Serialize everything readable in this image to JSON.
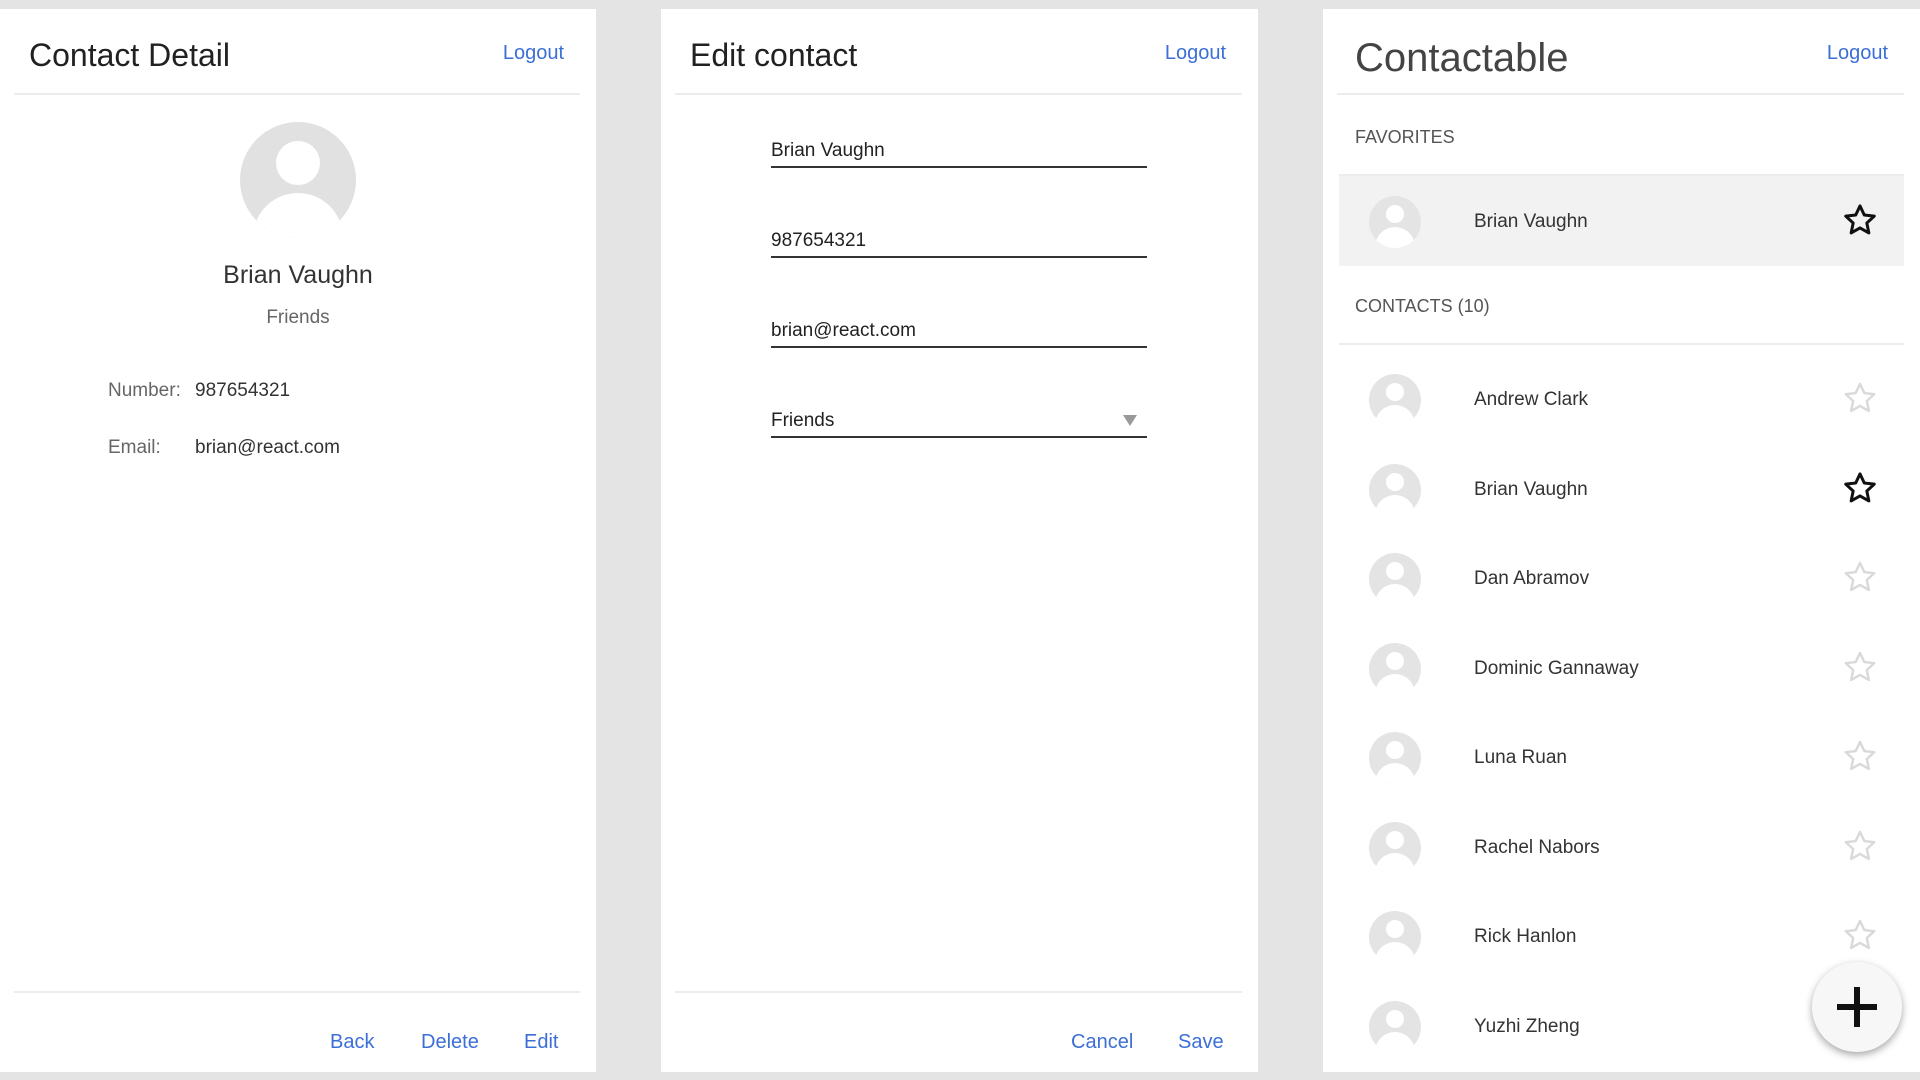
{
  "detail_panel": {
    "title": "Contact Detail",
    "logout_label": "Logout",
    "name": "Brian Vaughn",
    "group": "Friends",
    "number_label": "Number:",
    "number_value": "987654321",
    "email_label": "Email:",
    "email_value": "brian@react.com",
    "footer": {
      "back_label": "Back",
      "delete_label": "Delete",
      "edit_label": "Edit"
    }
  },
  "edit_panel": {
    "title": "Edit contact",
    "logout_label": "Logout",
    "name_value": "Brian Vaughn",
    "phone_value": "987654321",
    "email_value": "brian@react.com",
    "group_value": "Friends",
    "footer": {
      "cancel_label": "Cancel",
      "save_label": "Save"
    }
  },
  "list_panel": {
    "title": "Contactable",
    "logout_label": "Logout",
    "favorites_label": "FAVORITES",
    "favorites": [
      {
        "name": "Brian Vaughn",
        "starred": true
      }
    ],
    "contacts_label": "CONTACTS (10)",
    "contacts": [
      {
        "name": "Andrew Clark",
        "starred": false
      },
      {
        "name": "Brian Vaughn",
        "starred": true
      },
      {
        "name": "Dan Abramov",
        "starred": false
      },
      {
        "name": "Dominic Gannaway",
        "starred": false
      },
      {
        "name": "Luna Ruan",
        "starred": false
      },
      {
        "name": "Rachel Nabors",
        "starred": false
      },
      {
        "name": "Rick Hanlon",
        "starred": false
      },
      {
        "name": "Yuzhi Zheng",
        "starred": false
      }
    ],
    "fab_icon": "plus-icon"
  },
  "colors": {
    "accent": "#3b6fd6",
    "page_background": "#e4e4e4",
    "panel_background": "#ffffff",
    "favorite_row": "#f2f2f2",
    "star_filled": "#111111",
    "star_empty": "#d9d9d9"
  }
}
